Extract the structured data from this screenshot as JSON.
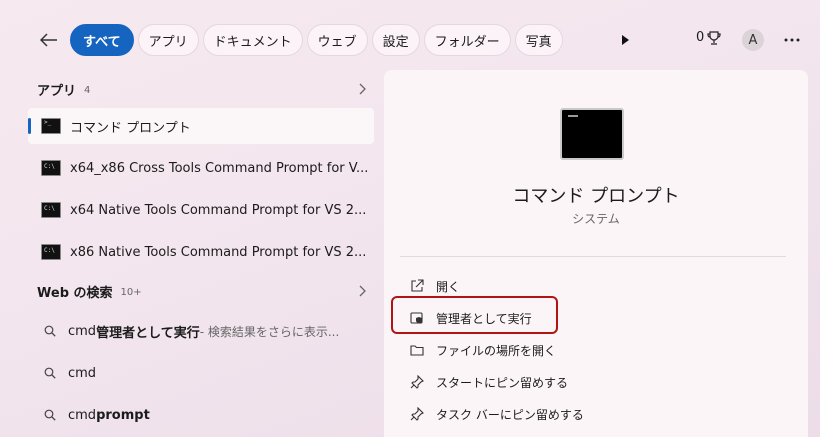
{
  "topbar": {
    "filters": [
      "すべて",
      "アプリ",
      "ドキュメント",
      "ウェブ",
      "設定",
      "フォルダー",
      "写真"
    ],
    "points": "0",
    "avatar_letter": "A"
  },
  "apps_section": {
    "title": "アプリ",
    "count": "4",
    "items": [
      "コマンド プロンプト",
      "x64_x86 Cross Tools Command Prompt for V...",
      "x64 Native Tools Command Prompt for VS 2...",
      "x86 Native Tools Command Prompt for VS 2..."
    ]
  },
  "web_section": {
    "title": "Web の検索",
    "count": "10+",
    "items": [
      {
        "prefix": "cmd ",
        "bold": "管理者として実行",
        "hint": " - 検索結果をさらに表示..."
      },
      {
        "prefix": "cmd",
        "bold": "",
        "hint": ""
      },
      {
        "prefix": "cmd ",
        "bold": "prompt",
        "hint": ""
      }
    ]
  },
  "detail": {
    "title": "コマンド プロンプト",
    "subtitle": "システム",
    "actions": [
      "開く",
      "管理者として実行",
      "ファイルの場所を開く",
      "スタートにピン留めする",
      "タスク バーにピン留めする"
    ]
  }
}
